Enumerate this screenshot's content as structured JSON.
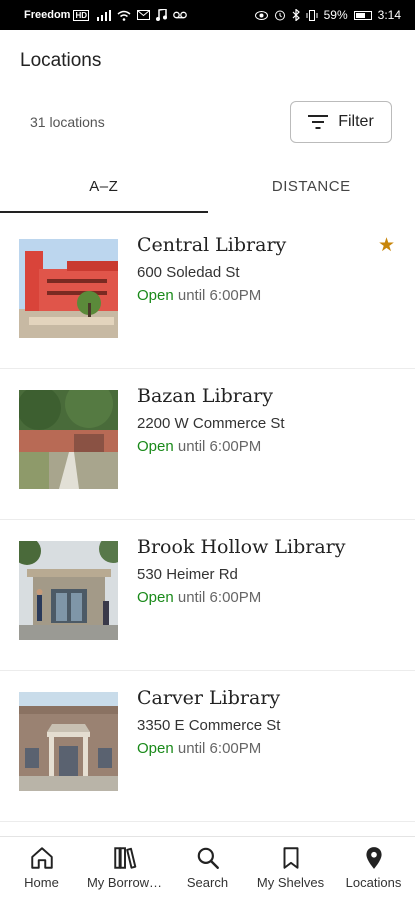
{
  "status_bar": {
    "carrier": "Freedom",
    "carrier_badge": "HD",
    "battery": "59%",
    "time": "3:14"
  },
  "header": {
    "title": "Locations",
    "count_label": "31 locations",
    "filter_label": "Filter"
  },
  "tabs": [
    {
      "label": "A–Z",
      "active": true
    },
    {
      "label": "DISTANCE",
      "active": false
    }
  ],
  "locations": [
    {
      "name": "Central Library",
      "address": "600 Soledad St",
      "status": "Open",
      "hours": "until 6:00PM",
      "favorite": true,
      "photo": "red-modern-building"
    },
    {
      "name": "Bazan Library",
      "address": "2200 W Commerce St",
      "status": "Open",
      "hours": "until 6:00PM",
      "favorite": false,
      "photo": "brick-building-with-trees"
    },
    {
      "name": "Brook Hollow Library",
      "address": "530 Heimer Rd",
      "status": "Open",
      "hours": "until 6:00PM",
      "favorite": false,
      "photo": "library-entrance-with-people"
    },
    {
      "name": "Carver Library",
      "address": "3350 E Commerce St",
      "status": "Open",
      "hours": "until 6:00PM",
      "favorite": false,
      "photo": "brick-building-portico"
    }
  ],
  "colors": {
    "open_green": "#1a8a1a",
    "star_gold": "#c8860a"
  },
  "bottom_nav": [
    {
      "label": "Home",
      "icon": "home-icon"
    },
    {
      "label": "My Borrow…",
      "icon": "books-icon"
    },
    {
      "label": "Search",
      "icon": "search-icon"
    },
    {
      "label": "My Shelves",
      "icon": "bookmark-icon"
    },
    {
      "label": "Locations",
      "icon": "location-pin-icon"
    }
  ]
}
